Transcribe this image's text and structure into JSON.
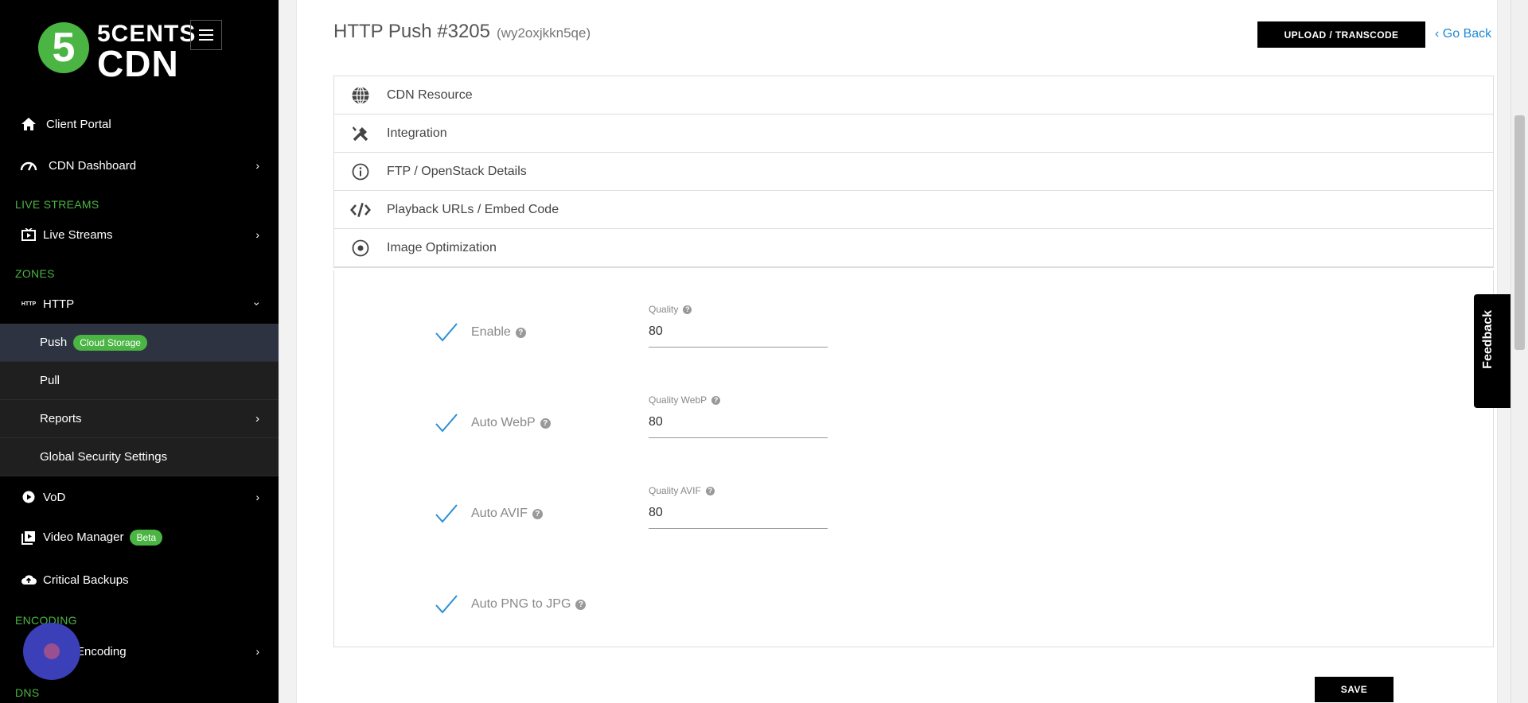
{
  "sidebar": {
    "logo": {
      "mark": "5",
      "line1": "5CENTS",
      "line2": "CDN"
    },
    "items_top": [
      {
        "label": "Client Portal"
      },
      {
        "label": "CDN Dashboard"
      }
    ],
    "section_live": "LIVE STREAMS",
    "live_streams": "Live Streams",
    "section_zones": "ZONES",
    "http_tag": "HTTP",
    "http": "HTTP",
    "http_sub": [
      {
        "label": "Push",
        "badge": "Cloud Storage"
      },
      {
        "label": "Pull"
      },
      {
        "label": "Reports"
      },
      {
        "label": "Global Security Settings"
      }
    ],
    "vod": "VoD",
    "video_manager": "Video Manager",
    "video_manager_badge": "Beta",
    "critical_backups": "Critical Backups",
    "section_encoding": "ENCODING",
    "encoding": "Encoding",
    "section_dns": "DNS"
  },
  "header": {
    "title": "HTTP Push #3205",
    "subtitle": "(wy2oxjkkn5qe)",
    "upload_label": "UPLOAD / TRANSCODE",
    "goback_label": "Go Back"
  },
  "accordion": [
    {
      "label": "CDN Resource",
      "icon": "globe-icon"
    },
    {
      "label": "Integration",
      "icon": "tools-icon"
    },
    {
      "label": "FTP / OpenStack Details",
      "icon": "info-icon"
    },
    {
      "label": "Playback URLs / Embed Code",
      "icon": "code-icon"
    },
    {
      "label": "Image Optimization",
      "icon": "dot-circle-icon"
    }
  ],
  "image_optimization": {
    "enable_label": "Enable",
    "quality_label": "Quality",
    "quality_value": "80",
    "auto_webp_label": "Auto WebP",
    "quality_webp_label": "Quality WebP",
    "quality_webp_value": "80",
    "auto_avif_label": "Auto AVIF",
    "quality_avif_label": "Quality AVIF",
    "quality_avif_value": "80",
    "auto_png_label": "Auto PNG to JPG",
    "help": "?",
    "save_label": "SAVE"
  },
  "feedback_label": "Feedback",
  "colors": {
    "accent": "#4bb543",
    "link": "#1f8ad6",
    "check": "#2a8fd6"
  }
}
